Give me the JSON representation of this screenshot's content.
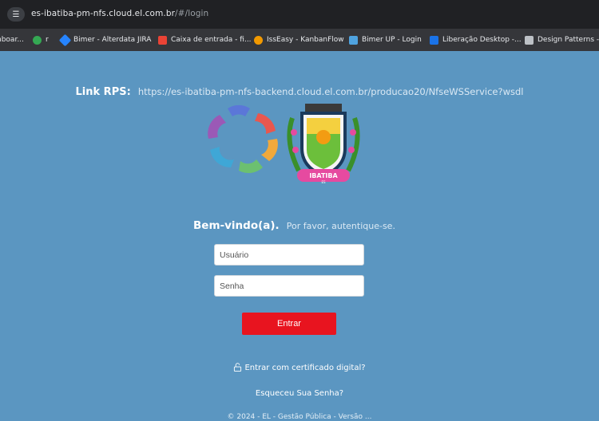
{
  "browser": {
    "url_host": "es-ibatiba-pm-nfs.cloud.el.com.br",
    "url_path": "/#/login",
    "bookmarks": [
      {
        "label": "nboar...",
        "icon": "bookmark-icon",
        "color": "#8ab4f8"
      },
      {
        "label": "r",
        "icon": "bookmark-icon",
        "color": "#34a853"
      },
      {
        "label": "Bimer - Alterdata JIRA",
        "icon": "jira-icon",
        "color": "#2684ff"
      },
      {
        "label": "Caixa de entrada - fi...",
        "icon": "gmail-icon",
        "color": "#ea4335"
      },
      {
        "label": "IssEasy - KanbanFlow",
        "icon": "kanbanflow-icon",
        "color": "#f29900"
      },
      {
        "label": "Bimer UP - Login",
        "icon": "bimer-icon",
        "color": "#4fa3e0"
      },
      {
        "label": "Liberação Desktop -...",
        "icon": "desktop-icon",
        "color": "#1a73e8"
      },
      {
        "label": "Design Patterns -",
        "icon": "page-icon",
        "color": "#bdc1c6"
      }
    ]
  },
  "page": {
    "rps_label": "Link RPS:",
    "rps_url": "https://es-ibatiba-pm-nfs-backend.cloud.el.com.br/producao20/NfseWSService?wsdl",
    "welcome_title": "Bem-vindo(a).",
    "welcome_sub": "Por favor, autentique-se.",
    "username_placeholder": "Usuário",
    "password_placeholder": "Senha",
    "enter_label": "Entrar",
    "certificate_label": "Entrar com certificado digital?",
    "forgot_label": "Esqueceu Sua Senha?",
    "footer_text": "© 2024 - EL - Gestão Pública - Versão ...",
    "seal_name": "IBATIBA",
    "seal_subtitle": "ES"
  },
  "colors": {
    "background": "#5b96c1",
    "enter_button": "#e8141f"
  }
}
